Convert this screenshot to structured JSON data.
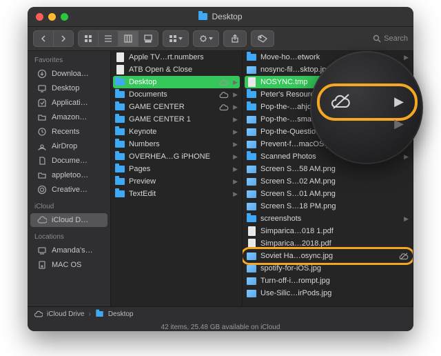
{
  "window": {
    "title": "Desktop"
  },
  "search": {
    "placeholder": "Search"
  },
  "sidebar": {
    "sections": [
      {
        "title": "Favorites",
        "items": [
          {
            "label": "Downloa…",
            "icon": "download-icon"
          },
          {
            "label": "Desktop",
            "icon": "desktop-icon"
          },
          {
            "label": "Applicati…",
            "icon": "apps-icon"
          },
          {
            "label": "Amazon…",
            "icon": "folder-icon"
          },
          {
            "label": "Recents",
            "icon": "clock-icon"
          },
          {
            "label": "AirDrop",
            "icon": "airdrop-icon"
          },
          {
            "label": "Docume…",
            "icon": "doc-icon"
          },
          {
            "label": "appletoo…",
            "icon": "folder-icon"
          },
          {
            "label": "Creative…",
            "icon": "cc-icon"
          }
        ]
      },
      {
        "title": "iCloud",
        "items": [
          {
            "label": "iCloud D…",
            "icon": "cloud-icon",
            "selected": true
          }
        ]
      },
      {
        "title": "Locations",
        "items": [
          {
            "label": "Amanda's…",
            "icon": "computer-icon"
          },
          {
            "label": "MAC OS",
            "icon": "disk-icon"
          }
        ]
      }
    ]
  },
  "col1": [
    {
      "name": "Apple TV…rt.numbers",
      "kind": "doc"
    },
    {
      "name": "ATB Open & Close",
      "kind": "doc"
    },
    {
      "name": "Desktop",
      "kind": "folder",
      "selected": true,
      "hasChildren": true,
      "cloud": true
    },
    {
      "name": "Documents",
      "kind": "folder",
      "hasChildren": true,
      "cloud": true
    },
    {
      "name": "GAME CENTER",
      "kind": "folder",
      "hasChildren": true,
      "cloud": true
    },
    {
      "name": "GAME CENTER 1",
      "kind": "folder",
      "hasChildren": true
    },
    {
      "name": "Keynote",
      "kind": "folder",
      "hasChildren": true
    },
    {
      "name": "Numbers",
      "kind": "folder",
      "hasChildren": true
    },
    {
      "name": "OVERHEA…G iPHONE",
      "kind": "folder",
      "hasChildren": true
    },
    {
      "name": "Pages",
      "kind": "folder",
      "hasChildren": true
    },
    {
      "name": "Preview",
      "kind": "folder",
      "hasChildren": true
    },
    {
      "name": "TextEdit",
      "kind": "folder",
      "hasChildren": true
    }
  ],
  "col2": [
    {
      "name": "Move-ho…etwork",
      "kind": "folder",
      "hasChildren": true
    },
    {
      "name": "nosync-fil…sktop.jpg",
      "kind": "img"
    },
    {
      "name": "NOSYNC.tmp",
      "kind": "doc",
      "selected": true,
      "nosync": true
    },
    {
      "name": "Peter's Resourc…",
      "kind": "folder",
      "hasChildren": true
    },
    {
      "name": "Pop-the-…ahjong",
      "kind": "folder",
      "hasChildren": true
    },
    {
      "name": "Pop-the-…small.jpg",
      "kind": "img"
    },
    {
      "name": "Pop-the-Question.jpg",
      "kind": "img"
    },
    {
      "name": "Prevent-f…macOS.jpg",
      "kind": "img"
    },
    {
      "name": "Scanned Photos",
      "kind": "folder",
      "hasChildren": true
    },
    {
      "name": "Screen S…58 AM.png",
      "kind": "img"
    },
    {
      "name": "Screen S…02 AM.png",
      "kind": "img"
    },
    {
      "name": "Screen S…01 AM.png",
      "kind": "img"
    },
    {
      "name": "Screen S…18 PM.png",
      "kind": "img"
    },
    {
      "name": "screenshots",
      "kind": "folder",
      "hasChildren": true
    },
    {
      "name": "Simparica…018 1.pdf",
      "kind": "pdf"
    },
    {
      "name": "Simparica…2018.pdf",
      "kind": "pdf"
    },
    {
      "name": "Soviet Ha…osync.jpg",
      "kind": "img",
      "nosync": true,
      "ring": true
    },
    {
      "name": "spotify-for-iOS.jpg",
      "kind": "img"
    },
    {
      "name": "Turn-off-i…rompt.jpg",
      "kind": "img"
    },
    {
      "name": "Use-Silic…irPods.jpg",
      "kind": "img"
    }
  ],
  "pathbar": {
    "a": "iCloud Drive",
    "b": "Desktop"
  },
  "status": "42 items, 25.48 GB available on iCloud"
}
